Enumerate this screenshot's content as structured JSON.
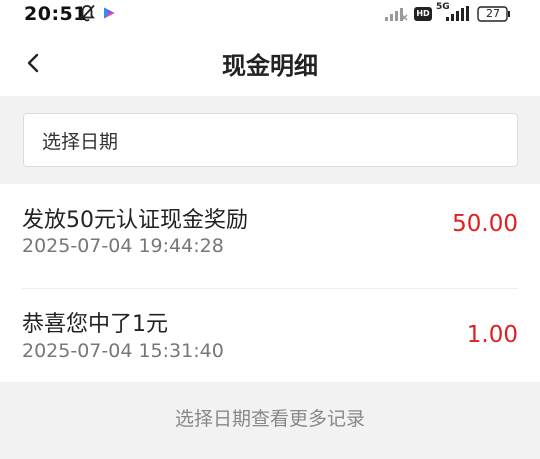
{
  "status_bar": {
    "time": "20:51",
    "battery": "27",
    "network": "5G",
    "hd": "HD",
    "icons": [
      "bell-muted-icon",
      "play-icon",
      "signal-icon",
      "hd-icon",
      "signal-5g-icon",
      "battery-icon"
    ]
  },
  "header": {
    "back_icon": "chevron-left-icon",
    "title": "现金明细"
  },
  "filter": {
    "placeholder": "选择日期"
  },
  "records": [
    {
      "title": "发放50元认证现金奖励",
      "time": "2025-07-04 19:44:28",
      "amount": "50.00"
    },
    {
      "title": "恭喜您中了1元",
      "time": "2025-07-04 15:31:40",
      "amount": "1.00"
    }
  ],
  "footer": {
    "hint": "选择日期查看更多记录"
  },
  "colors": {
    "amount": "#e02020",
    "background": "#f2f2f2",
    "card": "#ffffff"
  }
}
